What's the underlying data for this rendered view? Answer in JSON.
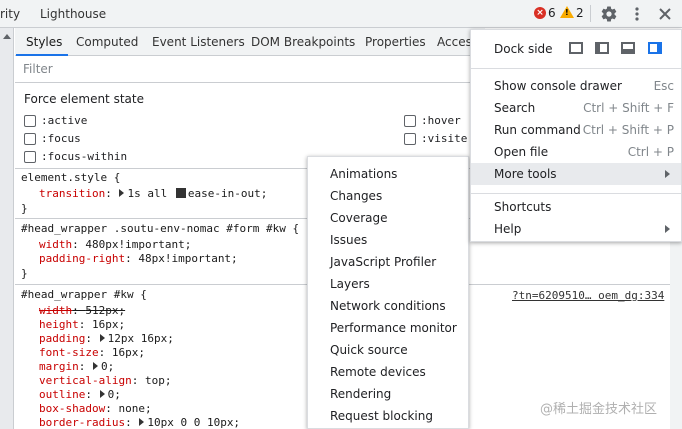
{
  "topbar": {
    "tabs": [
      "rity",
      "Lighthouse"
    ],
    "error_count": "6",
    "warning_count": "2",
    "settings_icon": "gear-icon",
    "more_icon": "kebab-icon",
    "close_icon": "close-icon"
  },
  "subtabs": [
    "Styles",
    "Computed",
    "Event Listeners",
    "DOM Breakpoints",
    "Properties",
    "Acces"
  ],
  "filter": {
    "placeholder": "Filter"
  },
  "force_state": {
    "title": "Force element state",
    "left": [
      ":active",
      ":focus",
      ":focus-within"
    ],
    "right": [
      ":hover",
      ":visite"
    ]
  },
  "rules": {
    "element_style": {
      "selector": "element.style {",
      "prop": "transition",
      "value_a": "1s all",
      "value_b": "ease-in-out;",
      "close": "}"
    },
    "rule2": {
      "selector": "#head_wrapper .soutu-env-nomac #form #kw {",
      "width_prop": "width",
      "width_val": "480px!important;",
      "pr_prop": "padding-right",
      "pr_val": "48px!important;",
      "close": "}"
    },
    "rule3": {
      "selector": "#head_wrapper #kw {",
      "source": "?tn=6209510… oem_dg:334",
      "decls": [
        {
          "prop": "width",
          "val": "512px;",
          "strike": true,
          "tri": false
        },
        {
          "prop": "height",
          "val": "16px;",
          "strike": false,
          "tri": false
        },
        {
          "prop": "padding",
          "val": "12px 16px;",
          "strike": false,
          "tri": true
        },
        {
          "prop": "font-size",
          "val": "16px;",
          "strike": false,
          "tri": false
        },
        {
          "prop": "margin",
          "val": "0;",
          "strike": false,
          "tri": true
        },
        {
          "prop": "vertical-align",
          "val": "top;",
          "strike": false,
          "tri": false
        },
        {
          "prop": "outline",
          "val": "0;",
          "strike": false,
          "tri": true
        },
        {
          "prop": "box-shadow",
          "val": "none;",
          "strike": false,
          "tri": false
        },
        {
          "prop": "border-radius",
          "val": "10px 0 0 10px;",
          "strike": false,
          "tri": true
        }
      ]
    }
  },
  "main_menu": {
    "dock_side_label": "Dock side",
    "items": [
      {
        "label": "Show console drawer",
        "shortcut": "Esc"
      },
      {
        "label": "Search",
        "shortcut": "Ctrl + Shift + F"
      },
      {
        "label": "Run command",
        "shortcut": "Ctrl + Shift + P"
      },
      {
        "label": "Open file",
        "shortcut": "Ctrl + P"
      },
      {
        "label": "More tools",
        "shortcut": ""
      }
    ],
    "items2": [
      {
        "label": "Shortcuts"
      },
      {
        "label": "Help"
      }
    ]
  },
  "more_tools": [
    "Animations",
    "Changes",
    "Coverage",
    "Issues",
    "JavaScript Profiler",
    "Layers",
    "Network conditions",
    "Performance monitor",
    "Quick source",
    "Remote devices",
    "Rendering",
    "Request blocking"
  ],
  "watermark": "@稀土掘金技术社区",
  "colors": {
    "accent": "#1a73e8",
    "error": "#d93025",
    "warning": "#f9ab00",
    "property": "#c80000"
  }
}
